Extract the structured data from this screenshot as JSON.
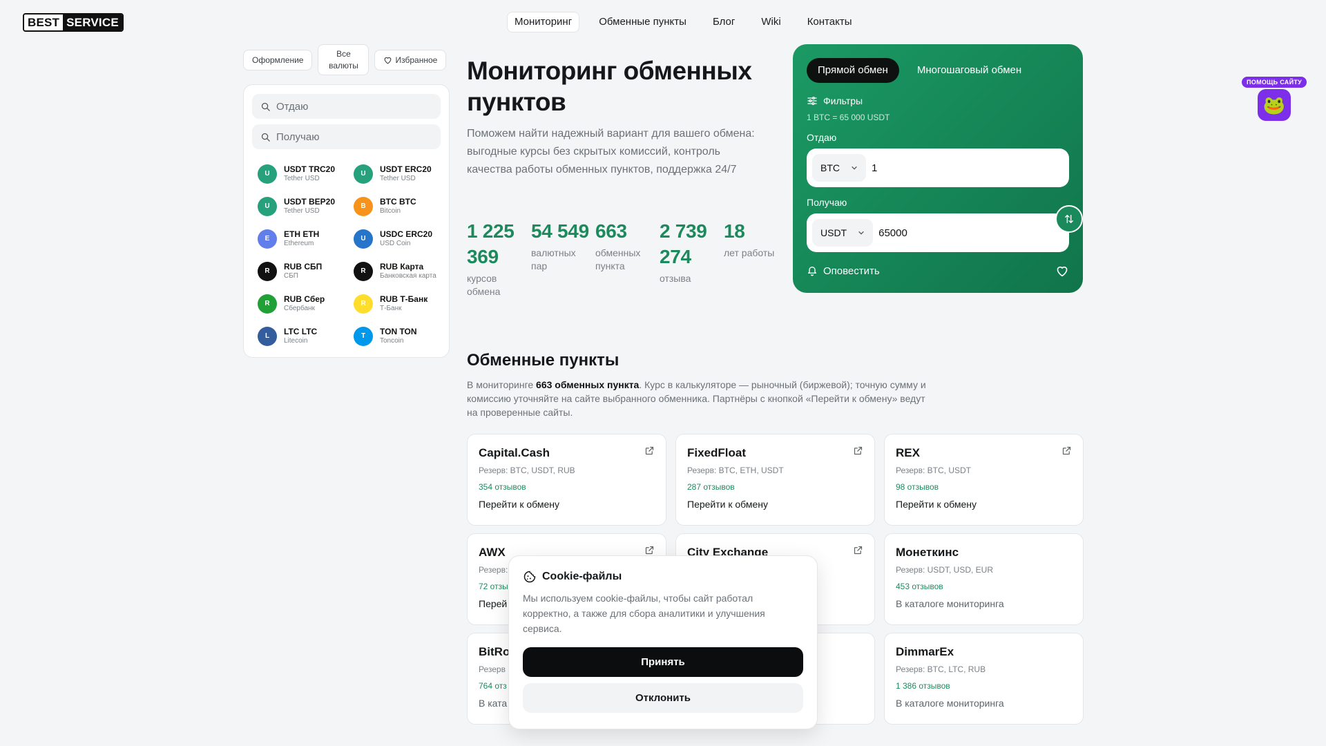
{
  "header": {
    "logo_left": "BEST",
    "logo_right": "SERVICE",
    "nav": [
      {
        "label": "Мониторинг",
        "active": true
      },
      {
        "label": "Обменные пункты",
        "active": false
      },
      {
        "label": "Блог",
        "active": false
      },
      {
        "label": "Wiki",
        "active": false
      },
      {
        "label": "Контакты",
        "active": false
      }
    ]
  },
  "sidebar": {
    "filter_design": "Оформление",
    "filter_all_line1": "Все",
    "filter_all_line2": "валюты",
    "filter_favorites": "Избранное",
    "search_give_placeholder": "Отдаю",
    "search_get_placeholder": "Получаю",
    "currencies": [
      {
        "letter": "U",
        "name": "USDT TRC20",
        "sub": "Tether USD",
        "color": "#26a17b"
      },
      {
        "letter": "U",
        "name": "USDT ERC20",
        "sub": "Tether USD",
        "color": "#26a17b"
      },
      {
        "letter": "U",
        "name": "USDT BEP20",
        "sub": "Tether USD",
        "color": "#26a17b"
      },
      {
        "letter": "B",
        "name": "BTC BTC",
        "sub": "Bitcoin",
        "color": "#f7931a"
      },
      {
        "letter": "E",
        "name": "ETH ETH",
        "sub": "Ethereum",
        "color": "#627eea"
      },
      {
        "letter": "U",
        "name": "USDC ERC20",
        "sub": "USD Coin",
        "color": "#2775ca"
      },
      {
        "letter": "R",
        "name": "RUB СБП",
        "sub": "СБП",
        "color": "#111111"
      },
      {
        "letter": "R",
        "name": "RUB Карта",
        "sub": "Банковская карта",
        "color": "#111111"
      },
      {
        "letter": "R",
        "name": "RUB Сбер",
        "sub": "Сбербанк",
        "color": "#21a038"
      },
      {
        "letter": "R",
        "name": "RUB Т-Банк",
        "sub": "Т-Банк",
        "color": "#ffdd2d"
      },
      {
        "letter": "L",
        "name": "LTC LTC",
        "sub": "Litecoin",
        "color": "#345d9d"
      },
      {
        "letter": "T",
        "name": "TON TON",
        "sub": "Toncoin",
        "color": "#0098ea"
      }
    ]
  },
  "hero": {
    "title": "Мониторинг обменных пунктов",
    "description": "Поможем найти надежный вариант для вашего обмена: выгодные курсы без скрытых комиссий, контроль качества работы обменных пунктов, поддержка 24/7",
    "stats": [
      {
        "value": "1 225 369",
        "label": "курсов обмена"
      },
      {
        "value": "54 549",
        "label": "валютных пар"
      },
      {
        "value": "663",
        "label": "обменных пункта"
      },
      {
        "value": "2 739 274",
        "label": "отзыва"
      },
      {
        "value": "18",
        "label": "лет работы"
      }
    ]
  },
  "exchange": {
    "tab_direct": "Прямой обмен",
    "tab_multistep": "Многошаговый обмен",
    "filters_label": "Фильтры",
    "rate": "1 BTC = 65 000 USDT",
    "give_label": "Отдаю",
    "give_currency": "BTC",
    "give_amount": "1",
    "get_label": "Получаю",
    "get_currency": "USDT",
    "get_amount": "65000",
    "notify_label": "Оповестить"
  },
  "help": {
    "badge": "ПОМОЩЬ САЙТУ",
    "emoji": "🐸"
  },
  "exchangers": {
    "title": "Обменные пункты",
    "desc_prefix": "В мониторинге ",
    "desc_bold": "663 обменных пункта",
    "desc_suffix": ". Курс в калькуляторе — рыночный (биржевой); точную сумму и комиссию уточняйте на сайте выбранного обменника. Партнёры с кнопкой «Перейти к обмену» ведут на проверенные сайты.",
    "cards": [
      {
        "name": "Capital.Cash",
        "reserve": "Резерв: BTC, USDT, RUB",
        "reviews": "354 отзывов",
        "link": "Перейти к обмену",
        "external": true
      },
      {
        "name": "FixedFloat",
        "reserve": "Резерв: BTC, ETH, USDT",
        "reviews": "287 отзывов",
        "link": "Перейти к обмену",
        "external": true
      },
      {
        "name": "REX",
        "reserve": "Резерв: BTC, USDT",
        "reviews": "98 отзывов",
        "link": "Перейти к обмену",
        "external": true
      },
      {
        "name": "AWX",
        "reserve": "Резерв:",
        "reviews": "72 отзы",
        "link": "Перей",
        "external": true
      },
      {
        "name": "City Exchange",
        "reserve": "",
        "reviews": "",
        "link": "",
        "external": true
      },
      {
        "name": "Монеткинс",
        "reserve": "Резерв: USDT, USD, EUR",
        "reviews": "453 отзывов",
        "link": "В каталоге мониторинга",
        "external": false
      },
      {
        "name": "BitRo",
        "reserve": "Резерв",
        "reviews": "764 отз",
        "link": "В ката",
        "external": false
      },
      {
        "name": "",
        "reserve": "",
        "reviews": "",
        "link": "",
        "external": false
      },
      {
        "name": "DimmarEx",
        "reserve": "Резерв: BTC, LTC, RUB",
        "reviews": "1 386 отзывов",
        "link": "В каталоге мониторинга",
        "external": false
      }
    ]
  },
  "cookie": {
    "title": "Cookie-файлы",
    "text": "Мы используем cookie-файлы, чтобы сайт работал корректно, а также для сбора аналитики и улучшения сервиса.",
    "accept": "Принять",
    "decline": "Отклонить"
  }
}
